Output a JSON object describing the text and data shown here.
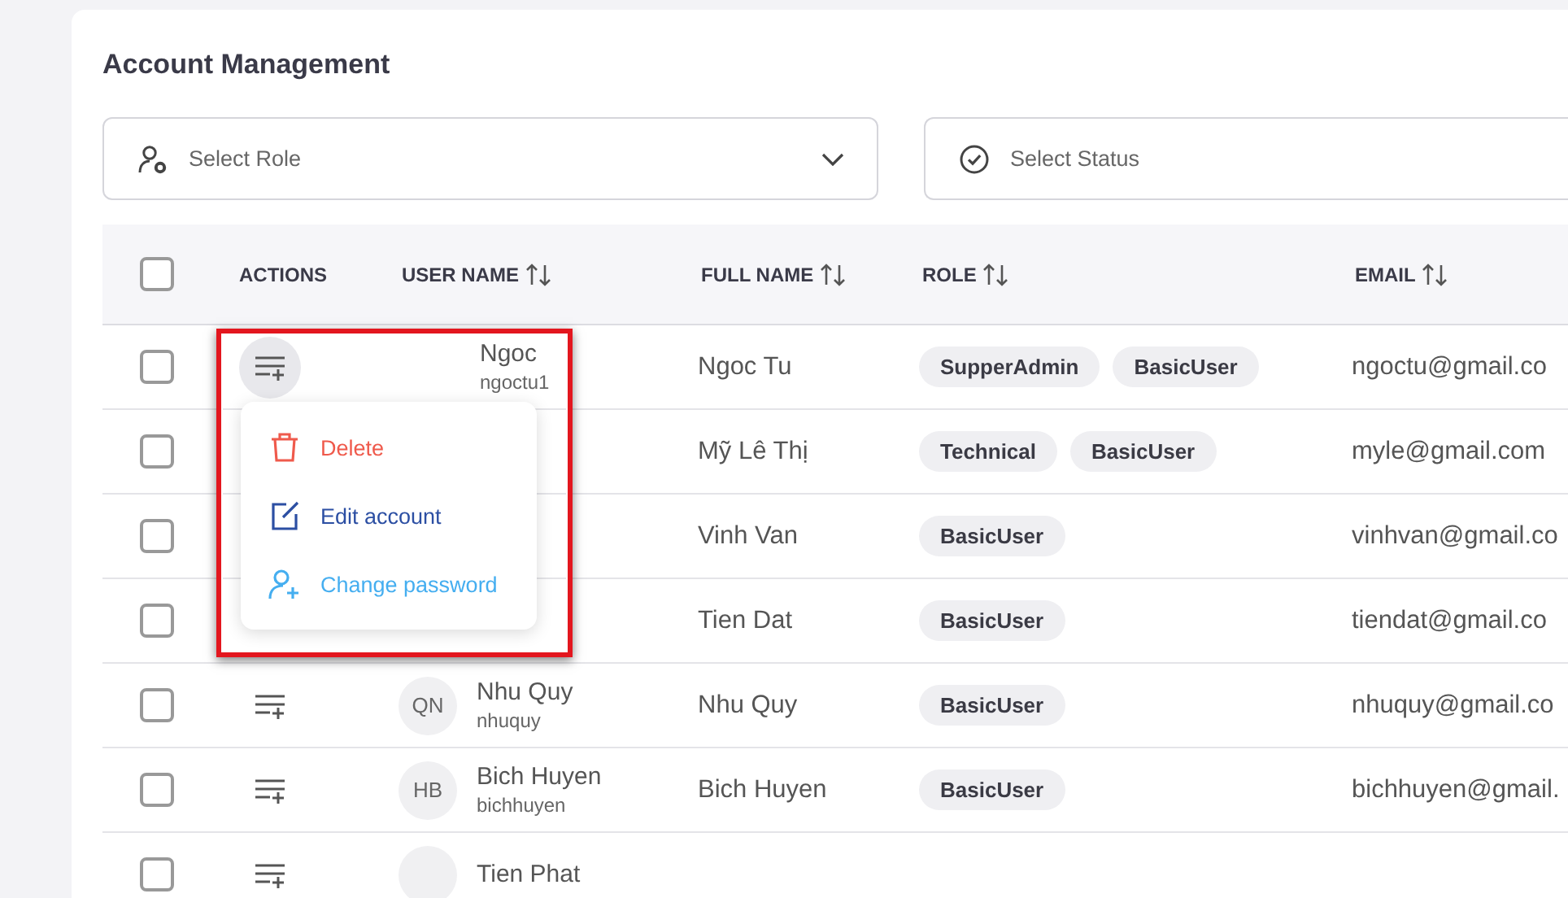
{
  "title": "Account Management",
  "filters": [
    {
      "kind": "role",
      "placeholder": "Select Role"
    },
    {
      "kind": "status",
      "placeholder": "Select Status"
    }
  ],
  "columns": [
    {
      "label": "ACTIONS",
      "kind": "plain"
    },
    {
      "label": "USER NAME",
      "kind": "sortable"
    },
    {
      "label": "FULL NAME",
      "kind": "sortable"
    },
    {
      "label": "ROLE",
      "kind": "sortable"
    },
    {
      "label": "EMAIL",
      "kind": "sortable"
    }
  ],
  "header_checked": false,
  "rows": [
    {
      "checked": false,
      "menu_open": true,
      "user": {
        "name": "Ngoc",
        "handle": "ngoctu1"
      },
      "full_name": "Ngoc Tu",
      "roles": [
        "SupperAdmin",
        "BasicUser"
      ],
      "email": "ngoctu@gmail.co"
    },
    {
      "checked": false,
      "menu_open": false,
      "full_name": "Mỹ Lê Thị",
      "roles": [
        "Technical",
        "BasicUser"
      ],
      "email": "myle@gmail.com"
    },
    {
      "checked": false,
      "menu_open": false,
      "full_name": "Vinh Van",
      "roles": [
        "BasicUser"
      ],
      "email": "vinhvan@gmail.co"
    },
    {
      "checked": false,
      "menu_open": false,
      "full_name": "Tien Dat",
      "roles": [
        "BasicUser"
      ],
      "email": "tiendat@gmail.co"
    },
    {
      "checked": false,
      "menu_open": false,
      "user": {
        "initials": "QN",
        "name": "Nhu Quy",
        "handle": "nhuquy"
      },
      "full_name": "Nhu Quy",
      "roles": [
        "BasicUser"
      ],
      "email": "nhuquy@gmail.co"
    },
    {
      "checked": false,
      "menu_open": false,
      "user": {
        "initials": "HB",
        "name": "Bich Huyen",
        "handle": "bichhuyen"
      },
      "full_name": "Bich Huyen",
      "roles": [
        "BasicUser"
      ],
      "email": "bichhuyen@gmail."
    },
    {
      "checked": false,
      "menu_open": false,
      "user": {
        "name": "Tien Phat"
      }
    }
  ],
  "action_menu": [
    {
      "kind": "delete",
      "label": "Delete"
    },
    {
      "kind": "edit",
      "label": "Edit account"
    },
    {
      "kind": "password",
      "label": "Change password"
    }
  ]
}
